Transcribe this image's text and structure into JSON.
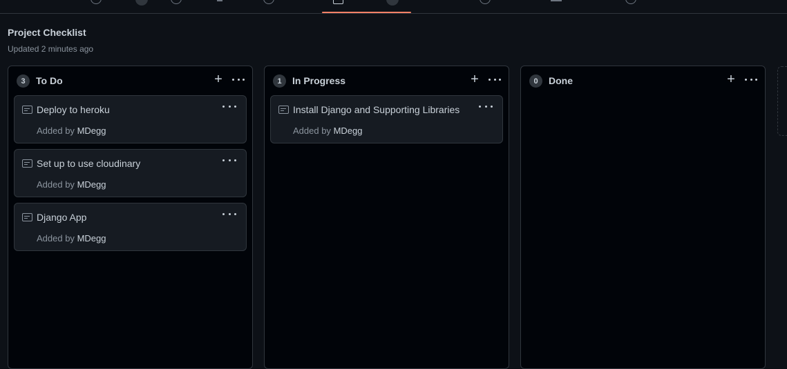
{
  "header": {
    "title": "Project Checklist",
    "subtitle": "Updated 2 minutes ago"
  },
  "columns": [
    {
      "name": "To Do",
      "count": "3",
      "cards": [
        {
          "title": "Deploy to heroku",
          "added_by_label": "Added by",
          "author": "MDegg"
        },
        {
          "title": "Set up to use cloudinary",
          "added_by_label": "Added by",
          "author": "MDegg"
        },
        {
          "title": "Django App",
          "added_by_label": "Added by",
          "author": "MDegg"
        }
      ]
    },
    {
      "name": "In Progress",
      "count": "1",
      "cards": [
        {
          "title": "Install Django and Supporting Libraries",
          "added_by_label": "Added by",
          "author": "MDegg"
        }
      ]
    },
    {
      "name": "Done",
      "count": "0",
      "cards": []
    }
  ],
  "icons": {
    "add": "plus-icon",
    "menu": "kebab-horizontal-icon",
    "note": "note-icon"
  },
  "colors": {
    "background": "#0d1117",
    "column_bg": "#010409",
    "card_bg": "#161b22",
    "border": "#30363d",
    "active_tab_underline": "#f78166"
  }
}
